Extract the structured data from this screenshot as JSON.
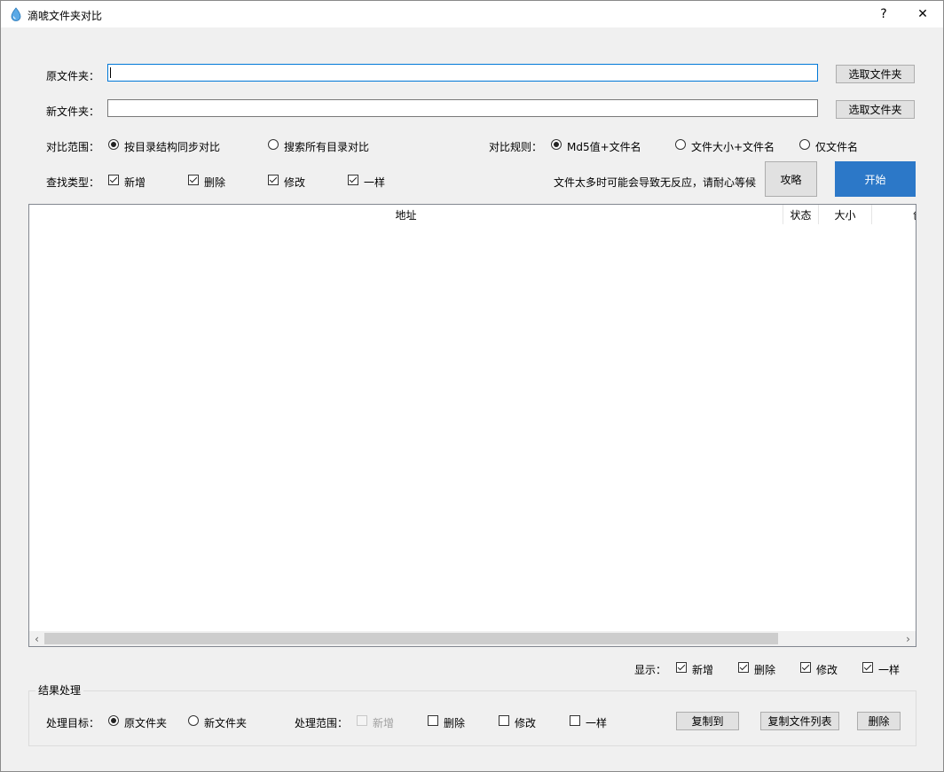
{
  "window": {
    "title": "滴唬文件夹对比",
    "help_label": "?",
    "close_label": "✕"
  },
  "source": {
    "label": "原文件夹：",
    "value": "",
    "browse_label": "选取文件夹"
  },
  "target": {
    "label": "新文件夹：",
    "value": "",
    "browse_label": "选取文件夹"
  },
  "scope": {
    "label": "对比范围：",
    "options": [
      {
        "label": "按目录结构同步对比",
        "selected": true
      },
      {
        "label": "搜索所有目录对比",
        "selected": false
      }
    ]
  },
  "rule": {
    "label": "对比规则：",
    "options": [
      {
        "label": "Md5值+文件名",
        "selected": true
      },
      {
        "label": "文件大小+文件名",
        "selected": false
      },
      {
        "label": "仅文件名",
        "selected": false
      }
    ]
  },
  "find_type": {
    "label": "查找类型：",
    "options": [
      {
        "label": "新增",
        "checked": true
      },
      {
        "label": "删除",
        "checked": true
      },
      {
        "label": "修改",
        "checked": true
      },
      {
        "label": "一样",
        "checked": true
      }
    ]
  },
  "notice": "文件太多时可能会导致无反应，请耐心等候",
  "guide_button": "攻略",
  "start_button": "开始",
  "table": {
    "columns": [
      "地址",
      "状态",
      "大小",
      "创"
    ]
  },
  "display": {
    "label": "显示：",
    "options": [
      {
        "label": "新增",
        "checked": true
      },
      {
        "label": "删除",
        "checked": true
      },
      {
        "label": "修改",
        "checked": true
      },
      {
        "label": "一样",
        "checked": true
      }
    ]
  },
  "result": {
    "group_title": "结果处理",
    "target_label": "处理目标：",
    "target_options": [
      {
        "label": "原文件夹",
        "selected": true
      },
      {
        "label": "新文件夹",
        "selected": false
      }
    ],
    "range_label": "处理范围：",
    "range_options": [
      {
        "label": "新增",
        "checked": false,
        "disabled": true
      },
      {
        "label": "删除",
        "checked": false,
        "disabled": false
      },
      {
        "label": "修改",
        "checked": false,
        "disabled": false
      },
      {
        "label": "一样",
        "checked": false,
        "disabled": false
      }
    ],
    "copy_to_button": "复制到",
    "copy_list_button": "复制文件列表",
    "delete_button": "删除"
  },
  "colors": {
    "accent": "#2c78c8",
    "focus_border": "#0078d7"
  }
}
